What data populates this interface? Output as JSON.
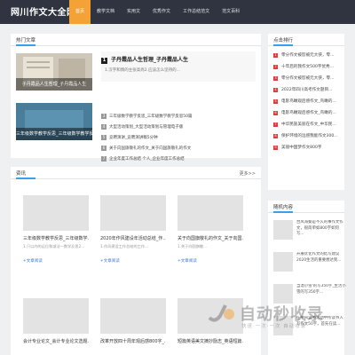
{
  "site": {
    "logo": "网川作文大全网"
  },
  "nav": [
    "首页",
    "教学文档",
    "实用文",
    "优秀作文",
    "工作总结范文",
    "范文百科"
  ],
  "hot": {
    "title": "热门文章",
    "thumb1_caption": "子丹霞品人生哲理_子丹霞品人生",
    "thumb2_caption": "三年级数学教学反思_三年级数学教学反思5篇",
    "featured": {
      "num": "1",
      "title": "子丹霞品人生哲理_子丹霞品人生",
      "desc": "1.汉字和情的主张高尚2.应该怎么坚持的..."
    },
    "list": [
      {
        "n": "3",
        "text": "三年级数学教学反思_三年级数学教学反思50篇"
      },
      {
        "n": "4",
        "text": "大型活动策划_大型活动策划与管理电子版"
      },
      {
        "n": "5",
        "text": "竞聘演讲_竞聘演讲稿5分钟"
      },
      {
        "n": "6",
        "text": "关于向国旗敬礼的作文_关于向国旗敬礼的作文"
      },
      {
        "n": "7",
        "text": "企业年度工作总结 个人_企业年度工作总结"
      }
    ]
  },
  "section2": {
    "title": "资讯",
    "more": "更多>>",
    "cards": [
      {
        "title": "三年级数学教学反思_三年级数学...",
        "desc": "1.只以内的运位和减法一数学反思2...",
        "link": "+文章阅读"
      },
      {
        "title": "2020年作风建设年活动总结_作...",
        "desc": "1.作风建设工作总结的工作...",
        "link": "+文章阅读"
      },
      {
        "title": "关于向国旗敬礼的作文_关于向国...",
        "desc": "1.关于向国旗敬...",
        "link": "+文章阅读"
      },
      {
        "title": "会计专业论文_会计专业论文选题...",
        "desc": "",
        "link": ""
      },
      {
        "title": "改革开放四十周年观后感800字_...",
        "desc": "",
        "link": ""
      },
      {
        "title": "短篇英语美文摘抄励志_英语短篇...",
        "desc": "",
        "link": ""
      }
    ]
  },
  "side": {
    "title": "点击排行",
    "list": [
      {
        "n": "1",
        "text": "零分作文被怼被元大侠，零..."
      },
      {
        "n": "2",
        "text": "十年后的我作文500字优秀..."
      },
      {
        "n": "3",
        "text": "零分作文被怼被元大侠，零..."
      },
      {
        "n": "4",
        "text": "2022年四川高考作文题目..."
      },
      {
        "n": "5",
        "text": "电影鸟瞰观后感作文_鸟瞰的..."
      },
      {
        "n": "6",
        "text": "电影鸟瞰观后感作文_鸟瞰的..."
      },
      {
        "n": "7",
        "text": "中华民族美丽在作文_中华民..."
      },
      {
        "n": "8",
        "text": "保护环境的远感我能作文300..."
      },
      {
        "n": "9",
        "text": "美丽中国梦作文800字"
      }
    ],
    "random_title": "随机内容",
    "random": [
      {
        "text": "台风海葵是不久的事作文作文，很简单如800字如何写..."
      },
      {
        "text": "开展优化作文的结写建议2020生活的重要想达到..."
      },
      {
        "text": "当温小雪'的写350字_生活小雪的写350字..."
      },
      {
        "text": "在中间读书活动中所读书入写作文50字，首先在读..."
      }
    ]
  },
  "watermark": {
    "main": "自动秒收录",
    "sub": "快速·一次·一次 自动收录"
  },
  "colors": {
    "accent": "#f4a236",
    "topbar": "#2f3440",
    "rank": "#e03c3c"
  }
}
